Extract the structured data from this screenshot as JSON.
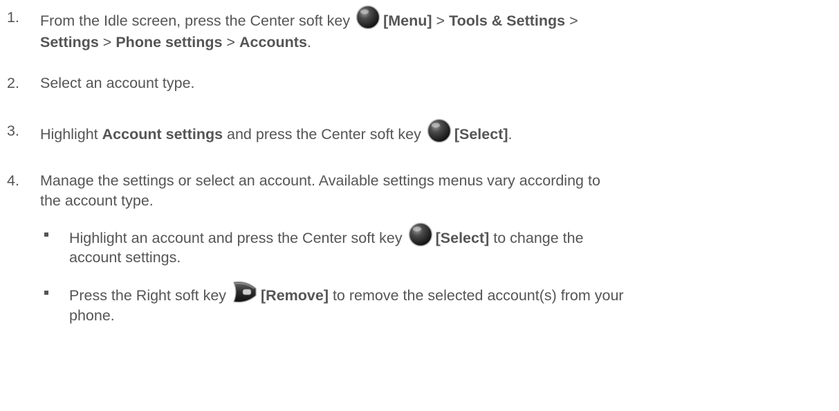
{
  "steps": [
    {
      "number": "1.",
      "line1": {
        "t1": "From the Idle screen, press the Center soft key ",
        "b1": "[Menu]",
        "t2": " > ",
        "b2": "Tools & Settings",
        "t3": " >"
      },
      "line2": {
        "b1": "Settings",
        "t1": " > ",
        "b2": "Phone settings",
        "t2": " > ",
        "b3": "Accounts",
        "t3": "."
      },
      "icon": "center-soft-key-icon"
    },
    {
      "number": "2.",
      "text": "Select an account type."
    },
    {
      "number": "3.",
      "t1": "Highlight ",
      "b1": "Account settings",
      "t2": " and press the Center soft key ",
      "b2": "[Select]",
      "t3": ".",
      "icon": "center-soft-key-icon"
    },
    {
      "number": "4.",
      "line1": "Manage the settings or select an account. Available settings menus vary according to",
      "line2": "the account type."
    }
  ],
  "bullets": [
    {
      "line1": {
        "t1": "Highlight an account and press the Center soft key ",
        "b1": "[Select]",
        "t2": " to change the"
      },
      "line2": "account settings.",
      "icon": "center-soft-key-icon"
    },
    {
      "line1": {
        "t1": "Press the Right soft key ",
        "b1": "[Remove]",
        "t2": " to remove the selected account(s) from your"
      },
      "line2": "phone.",
      "icon": "right-soft-key-icon"
    }
  ]
}
